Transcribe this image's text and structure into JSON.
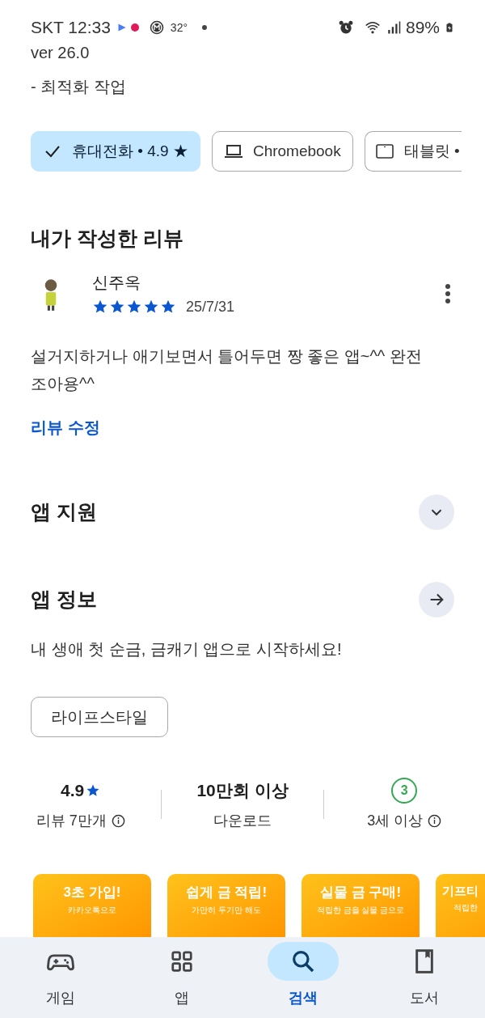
{
  "status_bar": {
    "carrier_time": "SKT 12:33",
    "temperature": "32°",
    "battery": "89%"
  },
  "whats_new": [
    "ver 26.0",
    "- 최적화 작업"
  ],
  "device_tabs": [
    {
      "label": "휴대전화 • 4.9 ★",
      "selected": true,
      "kind": "phone"
    },
    {
      "label": "Chromebook",
      "selected": false,
      "kind": "laptop"
    },
    {
      "label": "태블릿 •",
      "selected": false,
      "kind": "tablet"
    }
  ],
  "my_review": {
    "heading": "내가 작성한 리뷰",
    "author": "신주옥",
    "stars": 5,
    "date": "25/7/31",
    "text": "설거지하거나 애기보면서 틀어두면 짱 좋은 앱~^^ 완전 조아용^^",
    "edit_link": "리뷰 수정"
  },
  "sections": [
    {
      "title": "앱 지원",
      "kind": "expand"
    },
    {
      "title": "앱 정보",
      "kind": "arrow"
    }
  ],
  "description": "내 생애 첫 순금, 금캐기 앱으로 시작하세요!",
  "category_chip": "라이프스타일",
  "stats": [
    {
      "value": "4.9",
      "label": "리뷰 7만개",
      "kind": "rating"
    },
    {
      "value": "10만회 이상",
      "label": "다운로드",
      "kind": "plain"
    },
    {
      "value": "3",
      "label": "3세 이상",
      "kind": "age"
    }
  ],
  "screenshots": [
    {
      "title": "3초 가입!",
      "subtitle": "카카오톡으로"
    },
    {
      "title": "쉽게 금 적립!",
      "subtitle": "가만히 두기만 해도"
    },
    {
      "title": "실물 금 구매!",
      "subtitle": "적립한 금을 실물 금으로"
    },
    {
      "title": "기프티",
      "subtitle": "적립한"
    }
  ],
  "bottom_nav": [
    {
      "label": "게임",
      "selected": false,
      "kind": "games"
    },
    {
      "label": "앱",
      "selected": false,
      "kind": "apps"
    },
    {
      "label": "검색",
      "selected": true,
      "kind": "search"
    },
    {
      "label": "도서",
      "selected": false,
      "kind": "books"
    }
  ]
}
